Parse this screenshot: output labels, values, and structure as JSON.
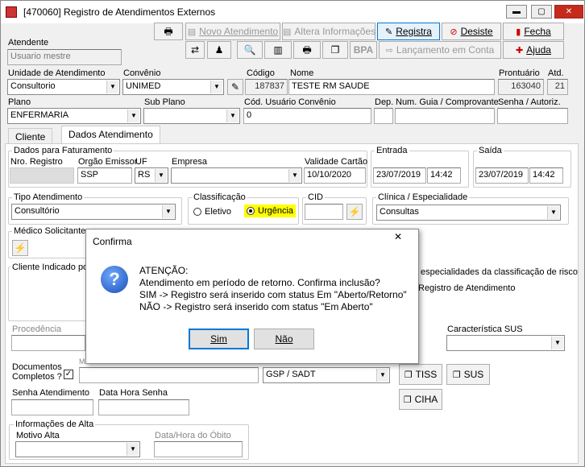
{
  "window": {
    "title": "[470060]  Registro de Atendimentos Externos"
  },
  "toolbar": {
    "novo": "Novo Atendimento",
    "altera": "Altera Informações",
    "registra": "Registra",
    "desiste": "Desiste",
    "fecha": "Fecha",
    "bpa": "BPA",
    "lancamento": "Lançamento em Conta",
    "ajuda": "Ajuda"
  },
  "atendente": {
    "label": "Atendente",
    "value": "Usuario mestre"
  },
  "row2": {
    "unidade_label": "Unidade de Atendimento",
    "unidade": "Consultorio",
    "convenio_label": "Convênio",
    "convenio": "UNIMED",
    "codigo_label": "Código",
    "codigo": "187837",
    "nome_label": "Nome",
    "nome": "TESTE RM SAUDE",
    "prontuario_label": "Prontuário",
    "prontuario": "163040",
    "atd_label": "Atd.",
    "atd": "21"
  },
  "row3": {
    "plano_label": "Plano",
    "plano": "ENFERMARIA",
    "subplano_label": "Sub Plano",
    "codusuario_label": "Cód. Usuário Convênio",
    "codusuario": "0",
    "dep_label": "Dep.",
    "guia_label": "Num. Guia / Comprovante",
    "senha_label": "Senha / Autoriz."
  },
  "tabs": {
    "cliente": "Cliente",
    "dados": "Dados Atendimento"
  },
  "faturamento": {
    "title": "Dados para Faturamento",
    "nro_label": "Nro. Registro",
    "orgao_label": "Orgão Emissor",
    "orgao": "SSP",
    "uf_label": "UF",
    "uf": "RS",
    "empresa_label": "Empresa",
    "validade_label": "Validade Cartão",
    "validade": "10/10/2020"
  },
  "entrada": {
    "title": "Entrada",
    "data": "23/07/2019",
    "hora": "14:42"
  },
  "saida": {
    "title": "Saída",
    "data": "23/07/2019",
    "hora": "14:42"
  },
  "tipo": {
    "title": "Tipo Atendimento",
    "value": "Consultório"
  },
  "classificacao": {
    "title": "Classificação",
    "eletivo": "Eletivo",
    "urgencia": "Urgência"
  },
  "cid": {
    "title": "CID"
  },
  "clinica": {
    "title": "Clínica / Especialidade",
    "value": "Consultas"
  },
  "medico": {
    "title": "Médico Solicitante"
  },
  "cliente_indicado": "Cliente Indicado po",
  "bg_texts": {
    "especialidades": "especialidades da classificação de risco",
    "registro": "Registro de Atendimento"
  },
  "procedencia_label": "Procedência",
  "caracteristica_label": "Característica SUS",
  "documentos": {
    "label1": "Documentos",
    "label2": "Completos ?",
    "guia": "GSP / SADT",
    "m": "M"
  },
  "buttons2": {
    "tiss": "TISS",
    "sus": "SUS",
    "ciha": "CIHA"
  },
  "senha_atend_label": "Senha Atendimento",
  "data_hora_senha_label": "Data Hora Senha",
  "alta": {
    "title": "Informações de Alta",
    "motivo_label": "Motivo Alta",
    "obito_label": "Data/Hora do Óbito"
  },
  "dialog": {
    "title": "Confirma",
    "line1": "ATENÇÃO:",
    "line2": "Atendimento em período de retorno. Confirma inclusão?",
    "line3": "SIM -> Registro será inserido com status Em \"Aberto/Retorno\"",
    "line4": "NÃO -> Registro será inserido com status \"Em Aberto\"",
    "sim": "Sim",
    "nao": "Não"
  }
}
